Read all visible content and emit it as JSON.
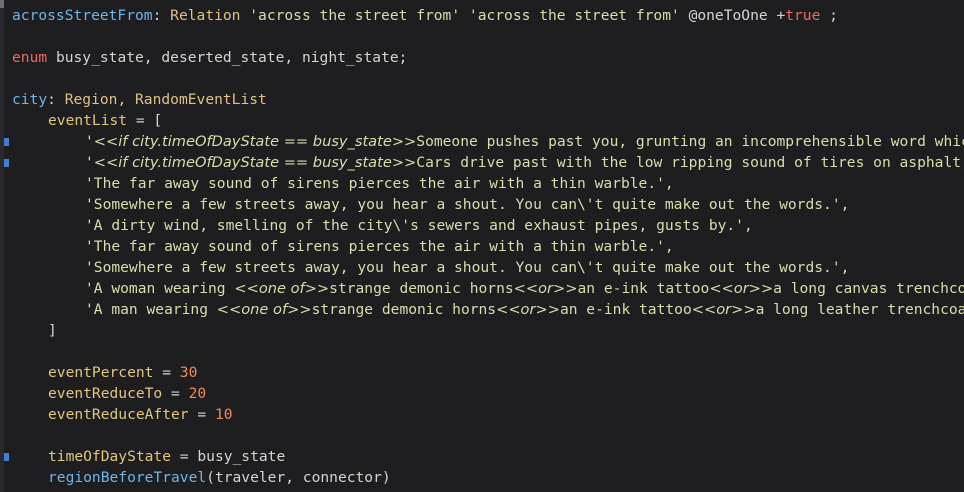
{
  "code": {
    "l1": {
      "name": "acrossStreetFrom",
      "colon": ": ",
      "class": "Relation",
      "s1": " 'across the street from' 'across the street from' ",
      "attr": "@oneToOne +",
      "kw": "true",
      "end": " ;"
    },
    "l2": {
      "kw": "enum",
      "rest": " busy_state, deserted_state, night_state;"
    },
    "l3": {
      "name": "city",
      "colon": ": ",
      "classes": "Region, RandomEventList"
    },
    "l4": {
      "prop": "eventList",
      "rest": " = ["
    },
    "l5": {
      "quote": "'",
      "macro": "<<if city.timeOfDayState == busy_state>>",
      "text": "Someone pushes past you, grunting an incomprehensible word which"
    },
    "l6": {
      "quote": "'",
      "macro": "<<if city.timeOfDayState == busy_state>>",
      "text": "Cars drive past with the low ripping sound of tires on asphalt, t"
    },
    "l7": "'The far away sound of sirens pierces the air with a thin warble.',",
    "l8": "'Somewhere a few streets away, you hear a shout. You can\\'t quite make out the words.',",
    "l9": "'A dirty wind, smelling of the city\\'s sewers and exhaust pipes, gusts by.',",
    "l10": "'The far away sound of sirens pierces the air with a thin warble.',",
    "l11": "'Somewhere a few streets away, you hear a shout. You can\\'t quite make out the words.',",
    "l12": {
      "pre": "'A woman wearing ",
      "m1": "<<one of>>",
      "t1": "strange demonic horns",
      "m2": "<<or>>",
      "t2": "an e-ink tattoo",
      "m3": "<<or>>",
      "t3": "a long canvas trenchcoat p"
    },
    "l13": {
      "pre": "'A man wearing ",
      "m1": "<<one of>>",
      "t1": "strange demonic horns",
      "m2": "<<or>>",
      "t2": "an e-ink tattoo",
      "m3": "<<or>>",
      "t3": "a long leather trenchcoat pu"
    },
    "l14": "]",
    "l16": {
      "prop": "eventPercent",
      "eq": " = ",
      "num": "30"
    },
    "l17": {
      "prop": "eventReduceTo",
      "eq": " = ",
      "num": "20"
    },
    "l18": {
      "prop": "eventReduceAfter",
      "eq": " = ",
      "num": "10"
    },
    "l20": {
      "prop": "timeOfDayState",
      "rest": " = busy_state"
    },
    "l21": {
      "func": "regionBeforeTravel",
      "rest": "(traveler, connector)"
    }
  },
  "colors": {
    "background": "#1e1e21",
    "keyword": "#ef6a5d",
    "type": "#6fb6e6",
    "string": "#dcdcaa",
    "number": "#f08b52",
    "property": "#e2c77a",
    "gutter_marker": "#3f7fd3"
  }
}
